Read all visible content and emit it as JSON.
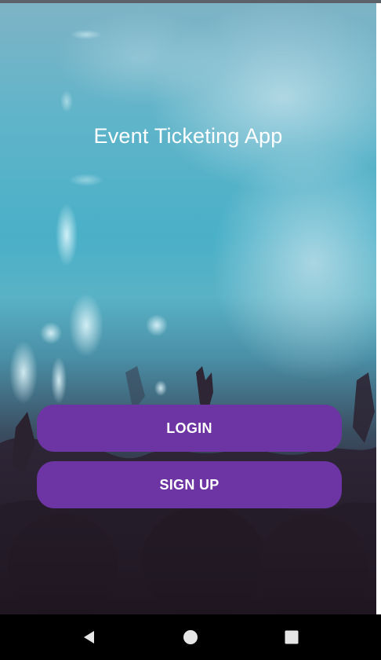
{
  "app": {
    "title": "Event Ticketing App"
  },
  "buttons": {
    "login_label": "LOGIN",
    "signup_label": "SIGN UP"
  },
  "navbar": {
    "icons": [
      "back-icon",
      "home-icon",
      "recents-icon"
    ]
  },
  "colors": {
    "button_bg": "#6c35a3",
    "button_text": "#ffffff",
    "title_text": "#ffffff",
    "navbar_bg": "#000000",
    "navbar_icon": "#e6e6e6"
  }
}
